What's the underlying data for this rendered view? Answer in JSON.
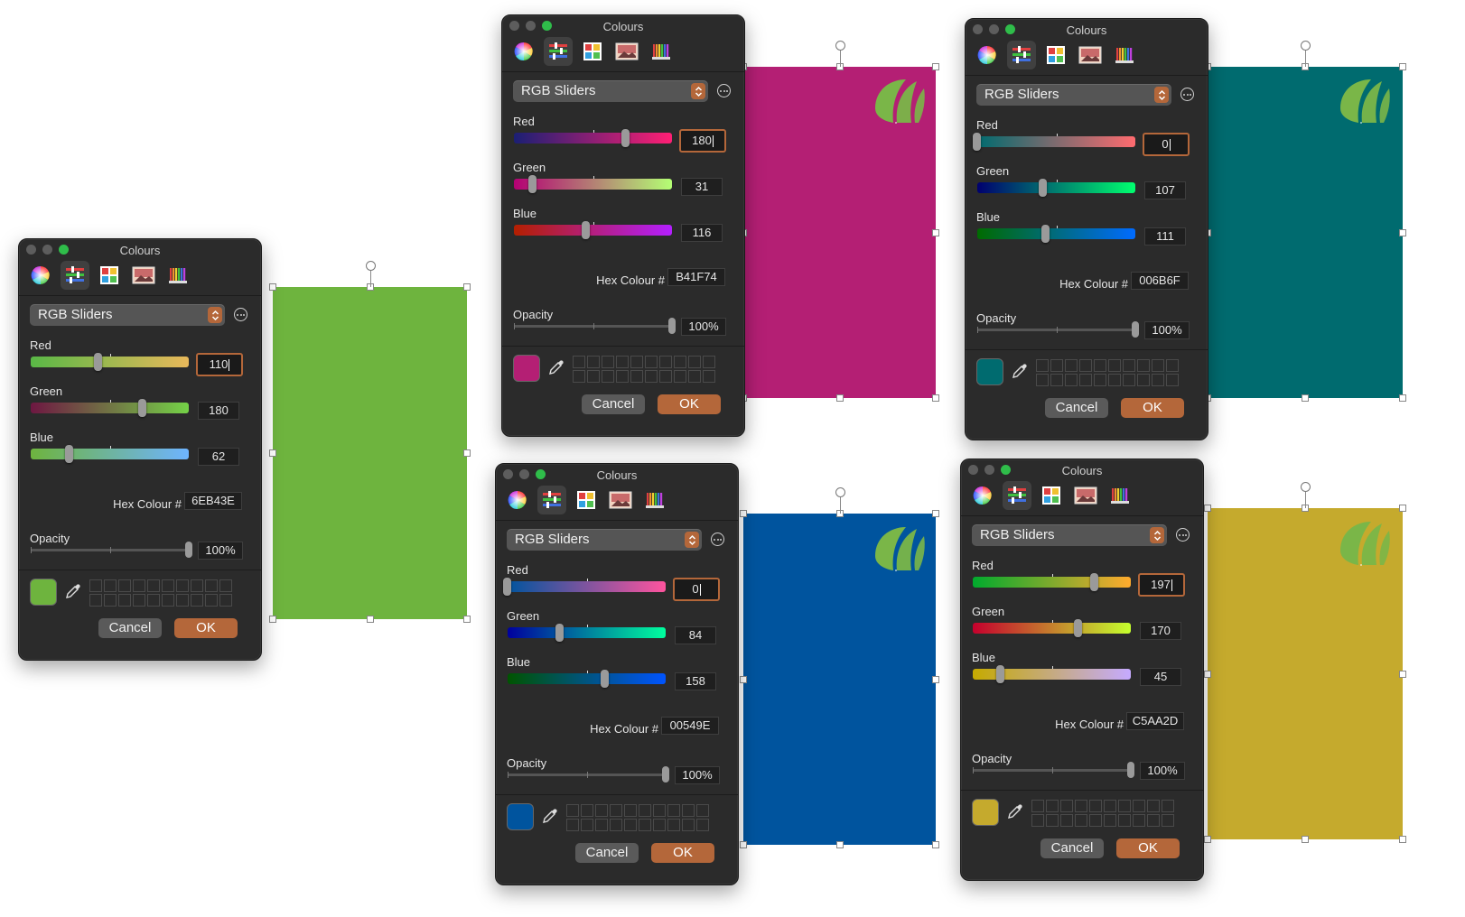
{
  "panels": [
    {
      "id": "p1",
      "title": "Colours",
      "mode": "RGB Sliders",
      "red": {
        "label": "Red",
        "value": "110",
        "level": 110,
        "track": [
          "#59b846",
          "#e8b85a"
        ]
      },
      "green": {
        "label": "Green",
        "value": "180",
        "level": 180,
        "track": [
          "#6e1742",
          "#74d247"
        ]
      },
      "blue": {
        "label": "Blue",
        "value": "62",
        "level": 62,
        "track": [
          "#6eb43e",
          "#6eb4ff"
        ]
      },
      "hex_label": "Hex Colour #",
      "hex": "6EB43E",
      "opacity_label": "Opacity",
      "opacity": "100%",
      "opacity_level": 1.0,
      "focused": "red",
      "color": "#6eb43e",
      "cancel": "Cancel",
      "ok": "OK"
    },
    {
      "id": "p2",
      "title": "Colours",
      "mode": "RGB Sliders",
      "red": {
        "label": "Red",
        "value": "180",
        "level": 180,
        "track": [
          "#1b1f74",
          "#ff1f74"
        ]
      },
      "green": {
        "label": "Green",
        "value": "31",
        "level": 31,
        "track": [
          "#b40074",
          "#b4ff74"
        ]
      },
      "blue": {
        "label": "Blue",
        "value": "116",
        "level": 116,
        "track": [
          "#b41f00",
          "#b41fff"
        ]
      },
      "hex_label": "Hex Colour #",
      "hex": "B41F74",
      "opacity_label": "Opacity",
      "opacity": "100%",
      "opacity_level": 1.0,
      "focused": "red",
      "color": "#b41f74",
      "cancel": "Cancel",
      "ok": "OK"
    },
    {
      "id": "p3",
      "title": "Colours",
      "mode": "RGB Sliders",
      "red": {
        "label": "Red",
        "value": "0",
        "level": 0,
        "track": [
          "#006b6f",
          "#ff6b6f"
        ]
      },
      "green": {
        "label": "Green",
        "value": "107",
        "level": 107,
        "track": [
          "#00006f",
          "#00ff6f"
        ]
      },
      "blue": {
        "label": "Blue",
        "value": "111",
        "level": 111,
        "track": [
          "#006b00",
          "#006bff"
        ]
      },
      "hex_label": "Hex Colour #",
      "hex": "006B6F",
      "opacity_label": "Opacity",
      "opacity": "100%",
      "opacity_level": 1.0,
      "focused": "red",
      "color": "#006b6f",
      "cancel": "Cancel",
      "ok": "OK"
    },
    {
      "id": "p4",
      "title": "Colours",
      "mode": "RGB Sliders",
      "red": {
        "label": "Red",
        "value": "0",
        "level": 0,
        "track": [
          "#00549e",
          "#ff549e"
        ]
      },
      "green": {
        "label": "Green",
        "value": "84",
        "level": 84,
        "track": [
          "#00009e",
          "#00ff9e"
        ]
      },
      "blue": {
        "label": "Blue",
        "value": "158",
        "level": 158,
        "track": [
          "#005400",
          "#0054ff"
        ]
      },
      "hex_label": "Hex Colour #",
      "hex": "00549E",
      "opacity_label": "Opacity",
      "opacity": "100%",
      "opacity_level": 1.0,
      "focused": "red",
      "color": "#00549e",
      "cancel": "Cancel",
      "ok": "OK"
    },
    {
      "id": "p5",
      "title": "Colours",
      "mode": "RGB Sliders",
      "red": {
        "label": "Red",
        "value": "197",
        "level": 197,
        "track": [
          "#00aa2d",
          "#ffaa2d"
        ]
      },
      "green": {
        "label": "Green",
        "value": "170",
        "level": 170,
        "track": [
          "#c5002d",
          "#c5ff2d"
        ]
      },
      "blue": {
        "label": "Blue",
        "value": "45",
        "level": 45,
        "track": [
          "#c5aa00",
          "#c5aaff"
        ]
      },
      "hex_label": "Hex Colour #",
      "hex": "C5AA2D",
      "opacity_label": "Opacity",
      "opacity": "100%",
      "opacity_level": 1.0,
      "focused": "red",
      "color": "#c5aa2d",
      "cancel": "Cancel",
      "ok": "OK"
    }
  ],
  "shapes": [
    {
      "id": "s1",
      "color": "#6eb43e",
      "logo": false
    },
    {
      "id": "s2",
      "color": "#b41f74",
      "logo": true
    },
    {
      "id": "s3",
      "color": "#006b6f",
      "logo": true
    },
    {
      "id": "s4",
      "color": "#00549e",
      "logo": true
    },
    {
      "id": "s5",
      "color": "#c5aa2d",
      "logo": true
    }
  ],
  "logo_color": "#7ab648",
  "icons": [
    "color-wheel-icon",
    "color-sliders-icon",
    "color-palettes-icon",
    "image-palettes-icon",
    "pencils-icon"
  ]
}
